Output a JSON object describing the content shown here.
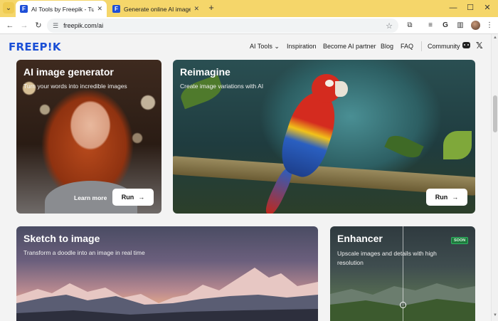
{
  "browser": {
    "tabs": [
      {
        "title": "AI Tools by Freepik - Turn any i",
        "favicon": "F",
        "active": true
      },
      {
        "title": "Generate online AI images with",
        "favicon": "F",
        "active": false
      }
    ],
    "url": "freepik.com/ai"
  },
  "site": {
    "logo": "FREEP!K",
    "nav": {
      "ai_tools": "AI Tools",
      "inspiration": "Inspiration",
      "partner": "Become AI partner",
      "blog": "Blog",
      "faq": "FAQ",
      "community": "Community"
    }
  },
  "cards": {
    "generator": {
      "title": "AI image generator",
      "subtitle": "Turn your words into incredible images",
      "learn_more": "Learn more",
      "run": "Run"
    },
    "reimagine": {
      "title": "Reimagine",
      "subtitle": "Create image variations with AI",
      "run": "Run"
    },
    "sketch": {
      "title": "Sketch to image",
      "subtitle": "Transform a doodle into an image in real time"
    },
    "enhancer": {
      "title": "Enhancer",
      "subtitle": "Upscale images and details with high resolution",
      "badge": "SOON"
    }
  },
  "icons": {
    "arrow": "→",
    "chevron": "⌄"
  }
}
